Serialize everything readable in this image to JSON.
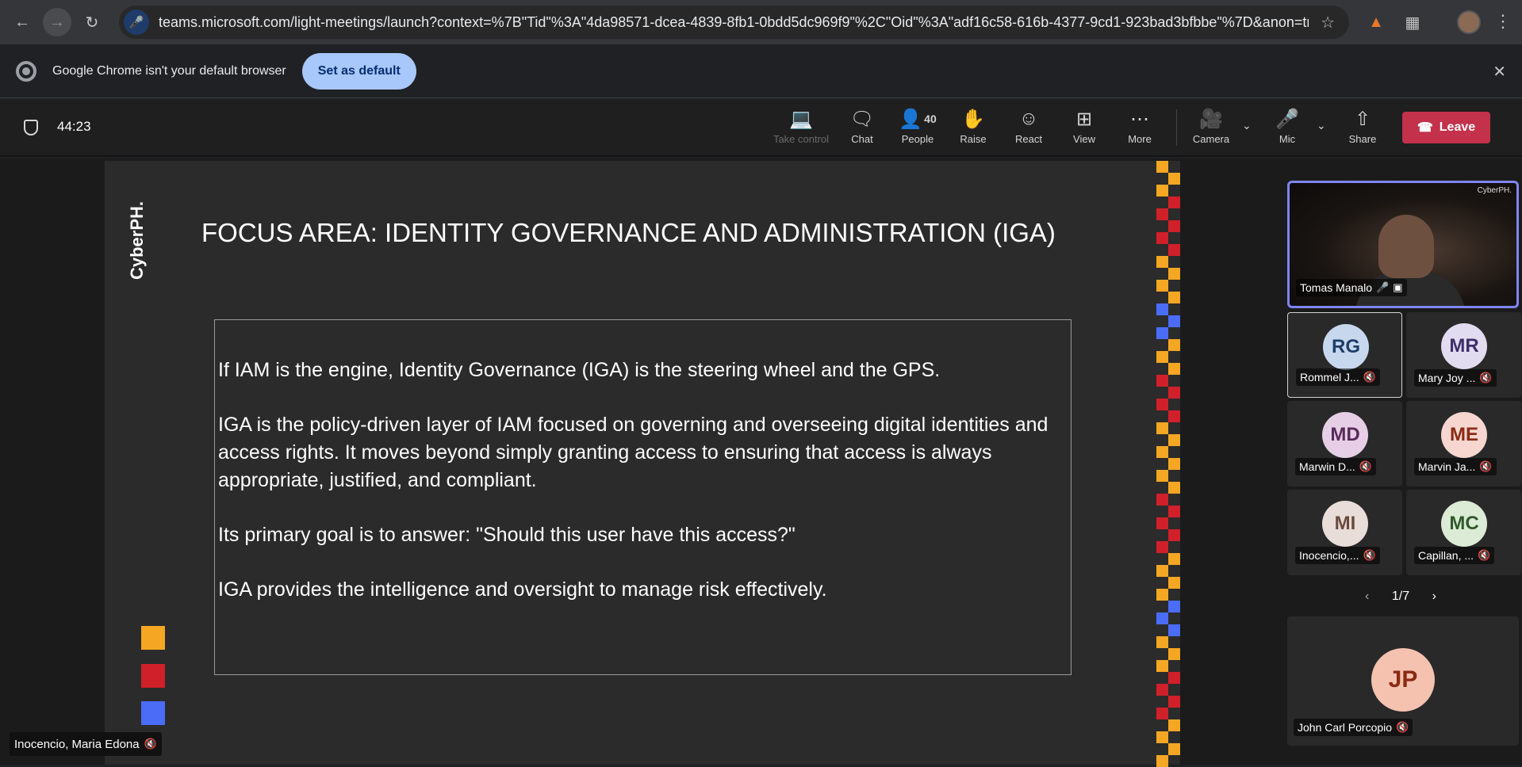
{
  "browser": {
    "url": "teams.microsoft.com/light-meetings/launch?context=%7B\"Tid\"%3A\"4da98571-dcea-4839-8fb1-0bdd5dc969f9\"%2C\"Oid\"%3A\"adf16c58-616b-4377-9cd1-923bad3bfbbe\"%7D&anon=tru..."
  },
  "infobar": {
    "message": "Google Chrome isn't your default browser",
    "button": "Set as default"
  },
  "meeting": {
    "timer": "44:23",
    "toolbar": {
      "take_control": "Take control",
      "chat": "Chat",
      "people": "People",
      "people_count": "40",
      "raise": "Raise",
      "react": "React",
      "view": "View",
      "more": "More",
      "camera": "Camera",
      "mic": "Mic",
      "share": "Share",
      "leave": "Leave"
    },
    "leave_color": "#c4314b"
  },
  "slide": {
    "brand": "CyberPH.",
    "title": "FOCUS AREA: IDENTITY GOVERNANCE AND ADMINISTRATION (IGA)",
    "paragraphs": [
      "If IAM is the engine, Identity Governance (IGA) is the steering wheel and the GPS.",
      "IGA is the policy-driven layer of IAM focused on governing and overseeing digital identities and access rights. It moves beyond simply granting access to ensuring that access is always appropriate, justified, and compliant.",
      "Its primary goal is to answer: \"Should this user have this access?\"",
      "IGA provides the intelligence and oversight to manage risk effectively."
    ],
    "accent_colors": [
      "#f5a623",
      "#d0202a",
      "#4a6cf7"
    ],
    "watermark": "CyberPH."
  },
  "presenter": {
    "name": "Inocencio, Maria Edona"
  },
  "gallery": {
    "featured": {
      "name": "Tomas Manalo"
    },
    "tiles": [
      {
        "initials": "RG",
        "name": "Rommel J...",
        "bg": "#c7d7ee",
        "fg": "#1d3d6b"
      },
      {
        "initials": "MR",
        "name": "Mary Joy ...",
        "bg": "#e2dcf0",
        "fg": "#3e2f6b"
      },
      {
        "initials": "MD",
        "name": "Marwin D...",
        "bg": "#e6cfe6",
        "fg": "#5a2a5a"
      },
      {
        "initials": "ME",
        "name": "Marvin Ja...",
        "bg": "#f7d6d0",
        "fg": "#8a2b12"
      },
      {
        "initials": "MI",
        "name": "Inocencio,...",
        "bg": "#e8ddd8",
        "fg": "#6b4a3e"
      },
      {
        "initials": "MC",
        "name": "Capillan, ...",
        "bg": "#dcebd6",
        "fg": "#2f5a2a"
      }
    ],
    "pager": "1/7",
    "big": {
      "initials": "JP",
      "name": "John Carl Porcopio"
    }
  }
}
